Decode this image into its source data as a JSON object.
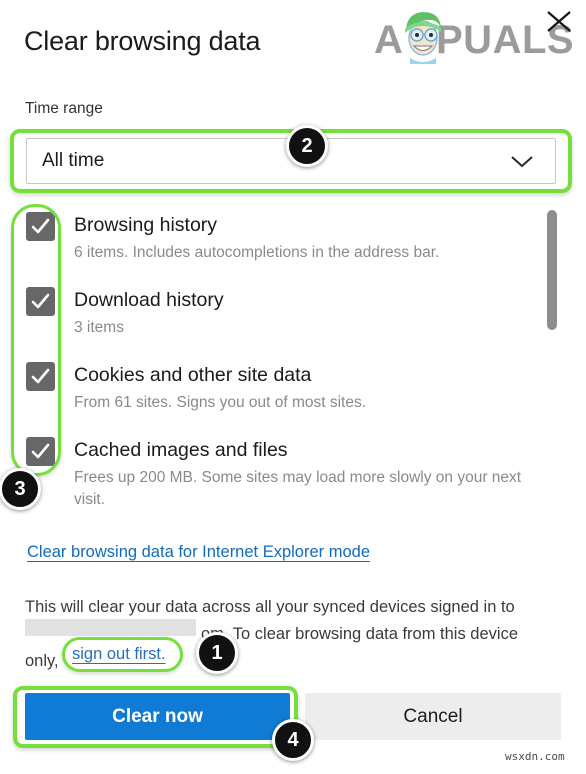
{
  "dialog": {
    "title": "Clear browsing data",
    "close_icon": "close-icon"
  },
  "brand": {
    "lead": "A",
    "rest": "PUALS",
    "mascot_icon": "mascot-icon"
  },
  "time_range": {
    "label": "Time range",
    "selected": "All time",
    "chevron_icon": "chevron-down-icon"
  },
  "options": [
    {
      "title": "Browsing history",
      "desc": "6 items. Includes autocompletions in the address bar.",
      "checked": true
    },
    {
      "title": "Download history",
      "desc": "3 items",
      "checked": true
    },
    {
      "title": "Cookies and other site data",
      "desc": "From 61 sites. Signs you out of most sites.",
      "checked": true
    },
    {
      "title": "Cached images and files",
      "desc": "Frees up 200 MB. Some sites may load more slowly on your next visit.",
      "checked": true
    }
  ],
  "links": {
    "ie_mode": "Clear browsing data for Internet Explorer mode",
    "sign_out": "sign out first."
  },
  "sync_note": {
    "line1": "This will clear your data across all your synced devices signed in to",
    "line2_tail": "om. To clear browsing data from this device",
    "line3_head": "only,"
  },
  "footer": {
    "clear_label": "Clear now",
    "cancel_label": "Cancel"
  },
  "badges": {
    "one": "1",
    "two": "2",
    "three": "3",
    "four": "4"
  },
  "watermark": "wsxdn.com",
  "colors": {
    "accent_blue": "#0f7bd4",
    "link_blue": "#0f6cbd",
    "highlight_green": "#76e03a",
    "checkbox_gray": "#676767",
    "cancel_gray": "#ededed"
  }
}
